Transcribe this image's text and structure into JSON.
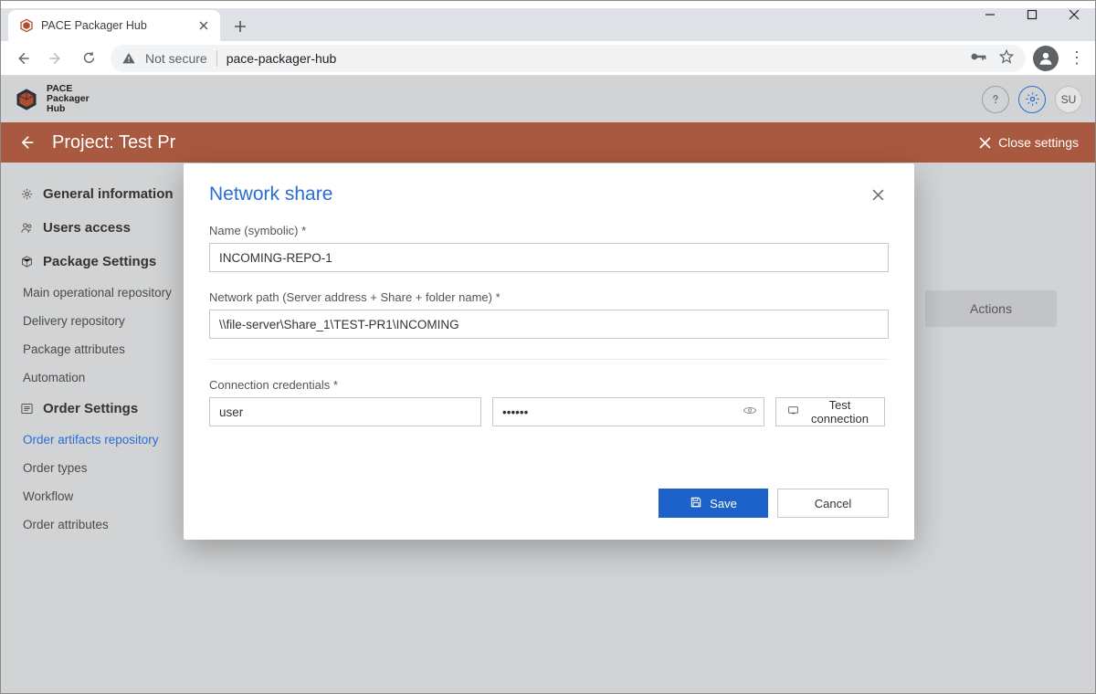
{
  "browser": {
    "tab_title": "PACE Packager Hub",
    "security_label": "Not secure",
    "url": "pace-packager-hub"
  },
  "brand": {
    "line1": "PACE",
    "line2": "Packager",
    "line3": "Hub"
  },
  "header_user_initials": "SU",
  "project_bar": {
    "title": "Project: Test Pr",
    "close_label": "Close settings"
  },
  "sidebar": {
    "sections": [
      {
        "label": "General information"
      },
      {
        "label": "Users access"
      },
      {
        "label": "Package Settings"
      },
      {
        "label": "Order Settings"
      }
    ],
    "package_items": [
      {
        "label": "Main operational repository"
      },
      {
        "label": "Delivery repository"
      },
      {
        "label": "Package attributes"
      },
      {
        "label": "Automation"
      }
    ],
    "order_items": [
      {
        "label": "Order artifacts repository"
      },
      {
        "label": "Order types"
      },
      {
        "label": "Workflow"
      },
      {
        "label": "Order attributes"
      }
    ]
  },
  "content": {
    "actions_label": "Actions"
  },
  "modal": {
    "title": "Network share",
    "name_label": "Name (symbolic) *",
    "name_value": "INCOMING-REPO-1",
    "path_label": "Network path (Server address + Share + folder name) *",
    "path_value": "\\\\file-server\\Share_1\\TEST-PR1\\INCOMING",
    "cred_label": "Connection credentials *",
    "user_value": "user",
    "password_masked": "••••••",
    "test_label": "Test connection",
    "save_label": "Save",
    "cancel_label": "Cancel"
  }
}
